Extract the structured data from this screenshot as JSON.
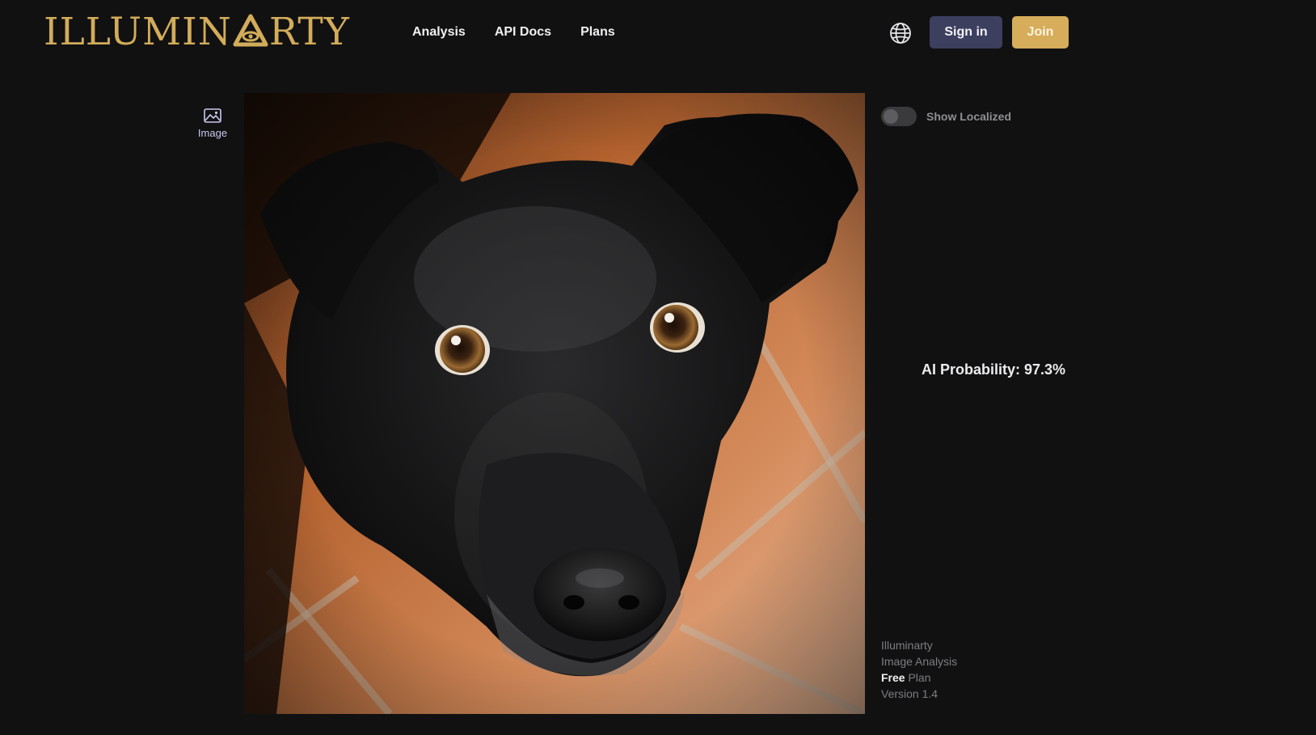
{
  "header": {
    "logo_text_left": "ILLUMIN",
    "logo_text_right": "RTY",
    "nav": [
      {
        "label": "Analysis"
      },
      {
        "label": "API Docs"
      },
      {
        "label": "Plans"
      }
    ],
    "signin_label": "Sign in",
    "join_label": "Join"
  },
  "tool": {
    "icon": "image-icon",
    "label": "Image"
  },
  "right_panel": {
    "toggle_label": "Show Localized",
    "toggle_on": false,
    "probability_text": "AI Probability: 97.3%",
    "footer": {
      "line1": "Illuminarty",
      "line2": "Image Analysis",
      "plan_bold": "Free",
      "plan_rest": "Plan",
      "version": "Version 1.4"
    }
  },
  "colors": {
    "background": "#111112",
    "brand_gold": "#d2ac5a",
    "signin_bg": "#3c3f5e",
    "join_bg": "#d6ad5a"
  },
  "icons": [
    "logo-pyramid-icon",
    "globe-icon",
    "image-icon"
  ]
}
